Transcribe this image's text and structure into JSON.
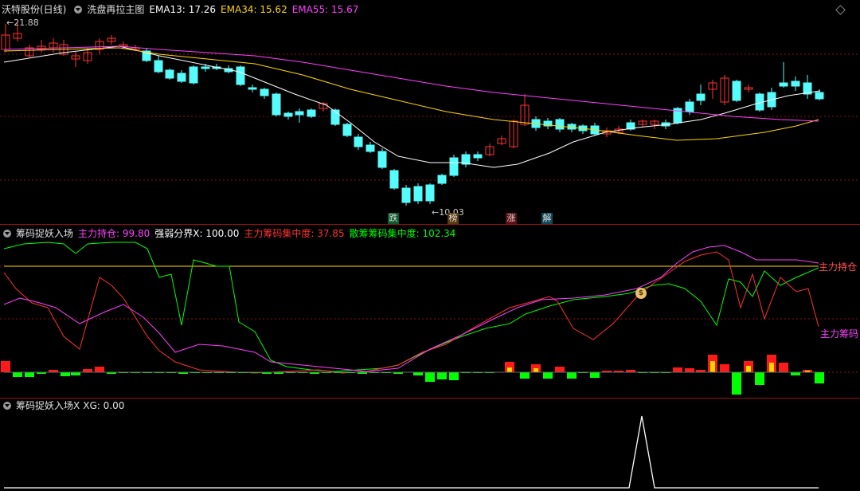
{
  "main": {
    "stock": "沃特股份(日线)",
    "indicator": "洗盘再拉主图",
    "ema13_label": "EMA13:",
    "ema13": "17.26",
    "ema34_label": "EMA34:",
    "ema34": "15.62",
    "ema55_label": "EMA55:",
    "ema55": "15.67",
    "high_label": "21.88",
    "low_label": "10.03",
    "signals": [
      "跌",
      "榜",
      "涨",
      "解"
    ],
    "colors": {
      "up": "#ff3232",
      "down": "#54fcfc",
      "ema13": "#ffffff",
      "ema34": "#ffd700",
      "ema55": "#ff40ff"
    }
  },
  "sub1": {
    "title": "筹码捉妖入场",
    "items": [
      {
        "label": "主力持仓:",
        "value": "99.80",
        "color": "#ff40ff"
      },
      {
        "label": "强弱分界X:",
        "value": "100.00",
        "color": "#ffffff"
      },
      {
        "label": "主力筹码集中度:",
        "value": "37.85",
        "color": "#ff3232"
      },
      {
        "label": "散筹筹码集中度:",
        "value": "102.34",
        "color": "#00ff00"
      }
    ],
    "right_label_1": "主力持仓",
    "right_label_2": "主力筹码",
    "money_icon": "money-bag-icon"
  },
  "sub2": {
    "title": "筹码捉妖入场X",
    "xg_label": "XG:",
    "xg": "0.00"
  }
}
